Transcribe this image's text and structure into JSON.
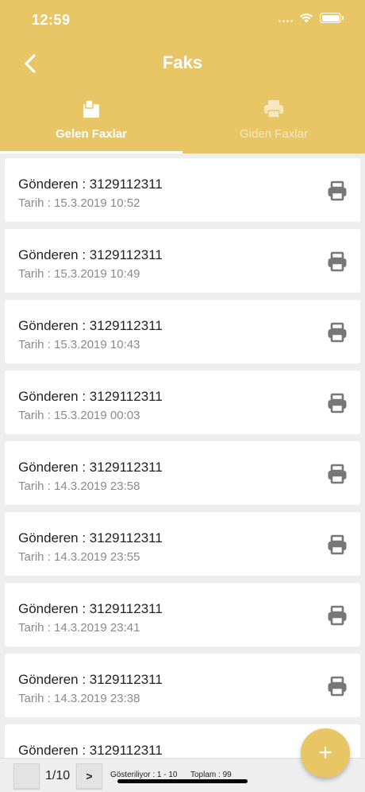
{
  "status_bar": {
    "time": "12:59"
  },
  "header": {
    "title": "Faks"
  },
  "tabs": [
    {
      "label": "Gelen Faxlar",
      "icon": "inbox-icon",
      "active": true
    },
    {
      "label": "Giden Faxlar",
      "icon": "printer-icon",
      "active": false
    }
  ],
  "faxes": [
    {
      "sender": "Gönderen : 3129112311",
      "date": "Tarih : 15.3.2019 10:52"
    },
    {
      "sender": "Gönderen : 3129112311",
      "date": "Tarih : 15.3.2019 10:49"
    },
    {
      "sender": "Gönderen : 3129112311",
      "date": "Tarih : 15.3.2019 10:43"
    },
    {
      "sender": "Gönderen : 3129112311",
      "date": "Tarih : 15.3.2019 00:03"
    },
    {
      "sender": "Gönderen : 3129112311",
      "date": "Tarih : 14.3.2019 23:58"
    },
    {
      "sender": "Gönderen : 3129112311",
      "date": "Tarih : 14.3.2019 23:55"
    },
    {
      "sender": "Gönderen : 3129112311",
      "date": "Tarih : 14.3.2019 23:41"
    },
    {
      "sender": "Gönderen : 3129112311",
      "date": "Tarih : 14.3.2019 23:38"
    },
    {
      "sender": "Gönderen : 3129112311",
      "date": ""
    }
  ],
  "pagination": {
    "prev_label": "",
    "page": "1/10",
    "next_label": ">",
    "showing": "Gösteriliyor : 1 - 10",
    "total": "Toplam : 99"
  },
  "fab": {
    "label": "+"
  },
  "colors": {
    "accent": "#e8c665",
    "icon_gray": "#777777",
    "background": "#eeeeee"
  }
}
